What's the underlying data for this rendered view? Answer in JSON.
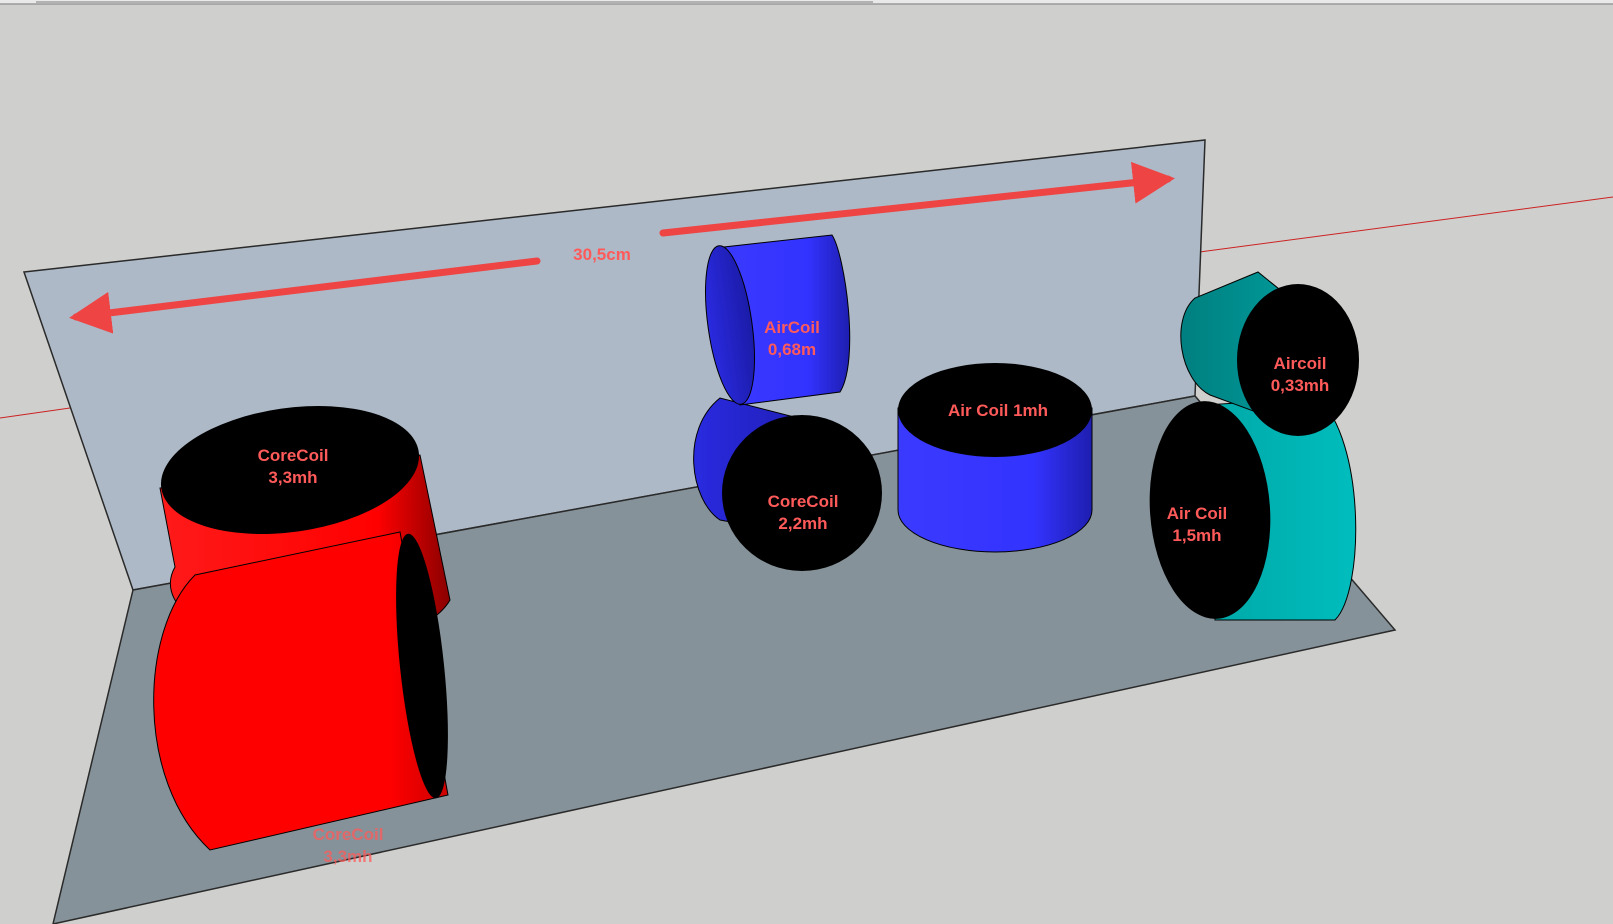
{
  "dimension": {
    "label": "30,5cm"
  },
  "coils": [
    {
      "id": "corecoil-back",
      "line1": "CoreCoil",
      "line2": "3,3mh",
      "color": "#ff0000"
    },
    {
      "id": "corecoil-front",
      "line1": "CoreCoil",
      "line2": "3,3mh",
      "color": "#ff0000"
    },
    {
      "id": "aircoil-068",
      "line1": "AirCoil",
      "line2": "0,68m",
      "color": "#3333ff"
    },
    {
      "id": "corecoil-22",
      "line1": "CoreCoil",
      "line2": "2,2mh",
      "color": "#3333ff"
    },
    {
      "id": "aircoil-1mh",
      "line1": "Air Coil 1mh",
      "color": "#3333ff"
    },
    {
      "id": "aircoil-15",
      "line1": "Air Coil",
      "line2": "1,5mh",
      "color": "#00b3b3"
    },
    {
      "id": "aircoil-033",
      "line1": "Aircoil",
      "line2": "0,33mh",
      "color": "#00b3b3"
    }
  ],
  "colors": {
    "background": "#cfcfcd",
    "back_panel": "#adb9c6",
    "base_panel": "#869299",
    "dimension_arrow": "#ee4444",
    "axis_line": "#cc2222"
  }
}
